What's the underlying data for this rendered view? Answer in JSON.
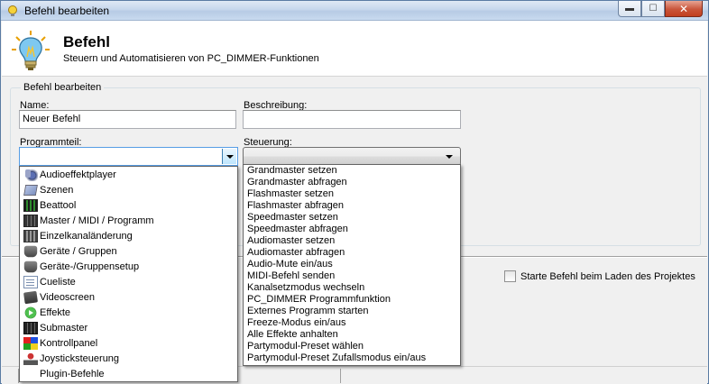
{
  "window": {
    "title": "Befehl bearbeiten",
    "controls": {
      "minimize": "▬",
      "maximize": "☐",
      "close": "✕"
    }
  },
  "header": {
    "title": "Befehl",
    "subtitle": "Steuern und Automatisieren von PC_DIMMER-Funktionen",
    "icon": "lightbulb-icon"
  },
  "group": {
    "legend": "Befehl bearbeiten",
    "name_label": "Name:",
    "name_value": "Neuer Befehl",
    "beschreibung_label": "Beschreibung:",
    "beschreibung_value": "",
    "programmteil_label": "Programmteil:",
    "programmteil_value": "",
    "steuerung_label": "Steuerung:",
    "steuerung_value": ""
  },
  "options": {
    "start_on_load_label": "Starte Befehl beim Laden des Projektes",
    "start_on_load_checked": false
  },
  "programmteil_list": [
    {
      "label": "Audioeffektplayer",
      "icon": "audio-icon"
    },
    {
      "label": "Szenen",
      "icon": "scene-icon"
    },
    {
      "label": "Beattool",
      "icon": "bars-icon"
    },
    {
      "label": "Master / MIDI / Programm",
      "icon": "master-icon"
    },
    {
      "label": "Einzelkanaländerung",
      "icon": "kanal-icon"
    },
    {
      "label": "Geräte / Gruppen",
      "icon": "geraete-icon"
    },
    {
      "label": "Geräte-/Gruppensetup",
      "icon": "geraete-icon"
    },
    {
      "label": "Cueliste",
      "icon": "cue-icon"
    },
    {
      "label": "Videoscreen",
      "icon": "video-icon"
    },
    {
      "label": "Effekte",
      "icon": "effekte-icon"
    },
    {
      "label": "Submaster",
      "icon": "sub-icon"
    },
    {
      "label": "Kontrollpanel",
      "icon": "kontroll-icon"
    },
    {
      "label": "Joysticksteuerung",
      "icon": "joy-icon"
    },
    {
      "label": "Plugin-Befehle",
      "icon": "none"
    }
  ],
  "steuerung_list": [
    "Grandmaster setzen",
    "Grandmaster abfragen",
    "Flashmaster setzen",
    "Flashmaster abfragen",
    "Speedmaster setzen",
    "Speedmaster abfragen",
    "Audiomaster setzen",
    "Audiomaster abfragen",
    "Audio-Mute ein/aus",
    "MIDI-Befehl senden",
    "Kanalsetzmodus wechseln",
    "PC_DIMMER Programmfunktion",
    "Externes Programm starten",
    "Freeze-Modus ein/aus",
    "Alle Effekte anhalten",
    "Partymodul-Preset wählen",
    "Partymodul-Preset Zufallsmodus ein/aus"
  ]
}
